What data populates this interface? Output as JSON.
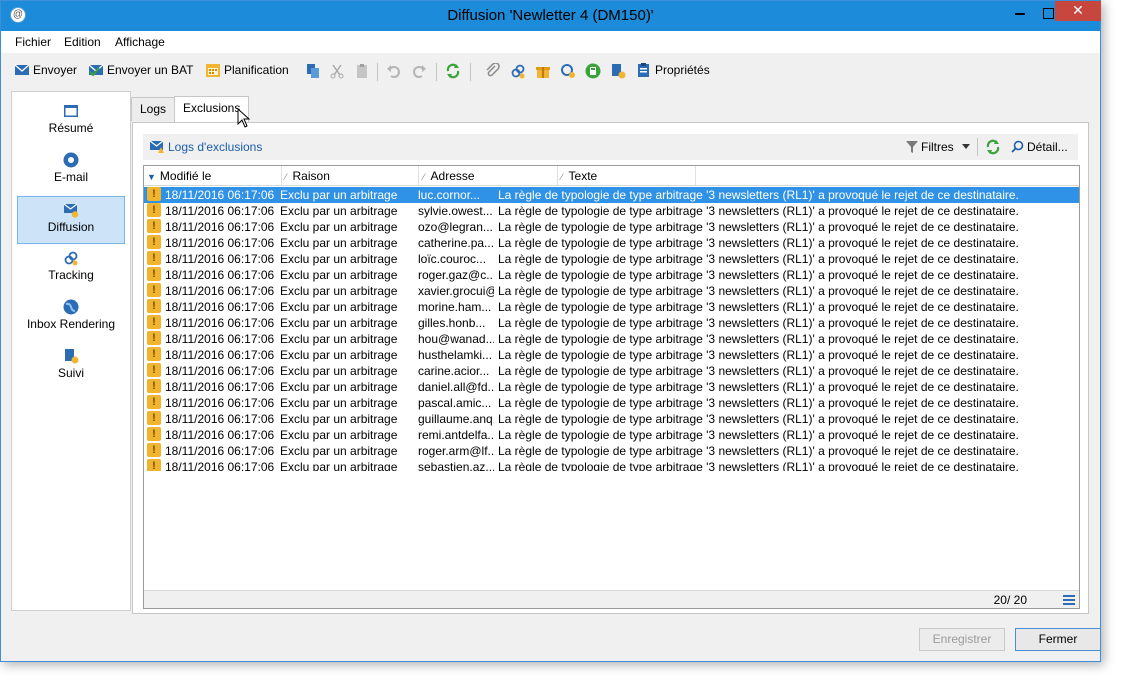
{
  "window": {
    "title": "Diffusion 'Newletter 4 (DM150)'",
    "close_glyph": "✕"
  },
  "menu": [
    "Fichier",
    "Edition",
    "Affichage"
  ],
  "toolbar": {
    "send": "Envoyer",
    "send_bat": "Envoyer un BAT",
    "schedule": "Planification",
    "properties": "Propriétés"
  },
  "sidebar": {
    "items": [
      {
        "label": "Résumé",
        "icon": "summary-icon"
      },
      {
        "label": "E-mail",
        "icon": "email-icon"
      },
      {
        "label": "Diffusion",
        "icon": "delivery-icon"
      },
      {
        "label": "Tracking",
        "icon": "tracking-icon"
      },
      {
        "label": "Inbox Rendering",
        "icon": "globe-icon"
      },
      {
        "label": "Suivi",
        "icon": "monitor-icon"
      }
    ],
    "active": "Diffusion"
  },
  "tabs": [
    "Logs",
    "Exclusions"
  ],
  "active_tab": "Exclusions",
  "panel": {
    "title": "Logs d'exclusions",
    "filters": "Filtres",
    "detail": "Détail..."
  },
  "table": {
    "columns": [
      "Modifié le",
      "Raison",
      "Adresse",
      "Texte"
    ],
    "rows": [
      {
        "date": "18/11/2016 06:17:06",
        "reason": "Exclu par un arbitrage",
        "address": "luc.cornor...",
        "text": "La règle de typologie de type arbitrage '3 newsletters (RL1)' a provoqué le rejet de ce destinataire."
      },
      {
        "date": "18/11/2016 06:17:06",
        "reason": "Exclu par un arbitrage",
        "address": "sylvie.owest...",
        "text": "La règle de typologie de type arbitrage '3 newsletters (RL1)' a provoqué le rejet de ce destinataire."
      },
      {
        "date": "18/11/2016 06:17:06",
        "reason": "Exclu par un arbitrage",
        "address": "ozo@legran...",
        "text": "La règle de typologie de type arbitrage '3 newsletters (RL1)' a provoqué le rejet de ce destinataire."
      },
      {
        "date": "18/11/2016 06:17:06",
        "reason": "Exclu par un arbitrage",
        "address": "catherine.pa...",
        "text": "La règle de typologie de type arbitrage '3 newsletters (RL1)' a provoqué le rejet de ce destinataire."
      },
      {
        "date": "18/11/2016 06:17:06",
        "reason": "Exclu par un arbitrage",
        "address": "loïc.couroc...",
        "text": "La règle de typologie de type arbitrage '3 newsletters (RL1)' a provoqué le rejet de ce destinataire."
      },
      {
        "date": "18/11/2016 06:17:06",
        "reason": "Exclu par un arbitrage",
        "address": "roger.gaz@c...",
        "text": "La règle de typologie de type arbitrage '3 newsletters (RL1)' a provoqué le rejet de ce destinataire."
      },
      {
        "date": "18/11/2016 06:17:06",
        "reason": "Exclu par un arbitrage",
        "address": "xavier.grocui@",
        "text": "La règle de typologie de type arbitrage '3 newsletters (RL1)' a provoqué le rejet de ce destinataire."
      },
      {
        "date": "18/11/2016 06:17:06",
        "reason": "Exclu par un arbitrage",
        "address": "morine.ham...",
        "text": "La règle de typologie de type arbitrage '3 newsletters (RL1)' a provoqué le rejet de ce destinataire."
      },
      {
        "date": "18/11/2016 06:17:06",
        "reason": "Exclu par un arbitrage",
        "address": "gilles.honb...",
        "text": "La règle de typologie de type arbitrage '3 newsletters (RL1)' a provoqué le rejet de ce destinataire."
      },
      {
        "date": "18/11/2016 06:17:06",
        "reason": "Exclu par un arbitrage",
        "address": "hou@wanad...",
        "text": "La règle de typologie de type arbitrage '3 newsletters (RL1)' a provoqué le rejet de ce destinataire."
      },
      {
        "date": "18/11/2016 06:17:06",
        "reason": "Exclu par un arbitrage",
        "address": "husthelamki...",
        "text": "La règle de typologie de type arbitrage '3 newsletters (RL1)' a provoqué le rejet de ce destinataire."
      },
      {
        "date": "18/11/2016 06:17:06",
        "reason": "Exclu par un arbitrage",
        "address": "carine.acior...",
        "text": "La règle de typologie de type arbitrage '3 newsletters (RL1)' a provoqué le rejet de ce destinataire."
      },
      {
        "date": "18/11/2016 06:17:06",
        "reason": "Exclu par un arbitrage",
        "address": "daniel.all@fd...",
        "text": "La règle de typologie de type arbitrage '3 newsletters (RL1)' a provoqué le rejet de ce destinataire."
      },
      {
        "date": "18/11/2016 06:17:06",
        "reason": "Exclu par un arbitrage",
        "address": "pascal.amic...",
        "text": "La règle de typologie de type arbitrage '3 newsletters (RL1)' a provoqué le rejet de ce destinataire."
      },
      {
        "date": "18/11/2016 06:17:06",
        "reason": "Exclu par un arbitrage",
        "address": "guillaume.anq.",
        "text": "La règle de typologie de type arbitrage '3 newsletters (RL1)' a provoqué le rejet de ce destinataire."
      },
      {
        "date": "18/11/2016 06:17:06",
        "reason": "Exclu par un arbitrage",
        "address": "remi.antdelfa...",
        "text": "La règle de typologie de type arbitrage '3 newsletters (RL1)' a provoqué le rejet de ce destinataire."
      },
      {
        "date": "18/11/2016 06:17:06",
        "reason": "Exclu par un arbitrage",
        "address": "roger.arm@lf...",
        "text": "La règle de typologie de type arbitrage '3 newsletters (RL1)' a provoqué le rejet de ce destinataire."
      },
      {
        "date": "18/11/2016 06:17:06",
        "reason": "Exclu par un arbitrage",
        "address": "sebastien.az...",
        "text": "La règle de typologie de type arbitrage '3 newsletters (RL1)' a provoqué le rejet de ce destinataire."
      }
    ],
    "selected_index": 0,
    "count": "20/ 20",
    "warn_glyph": "!"
  },
  "buttons": {
    "save": "Enregistrer",
    "close": "Fermer"
  },
  "colors": {
    "titlebar": "#1c8bd9",
    "selection": "#3092e6",
    "close": "#c7463e",
    "warning": "#f1b42f",
    "link": "#1b5da8"
  }
}
